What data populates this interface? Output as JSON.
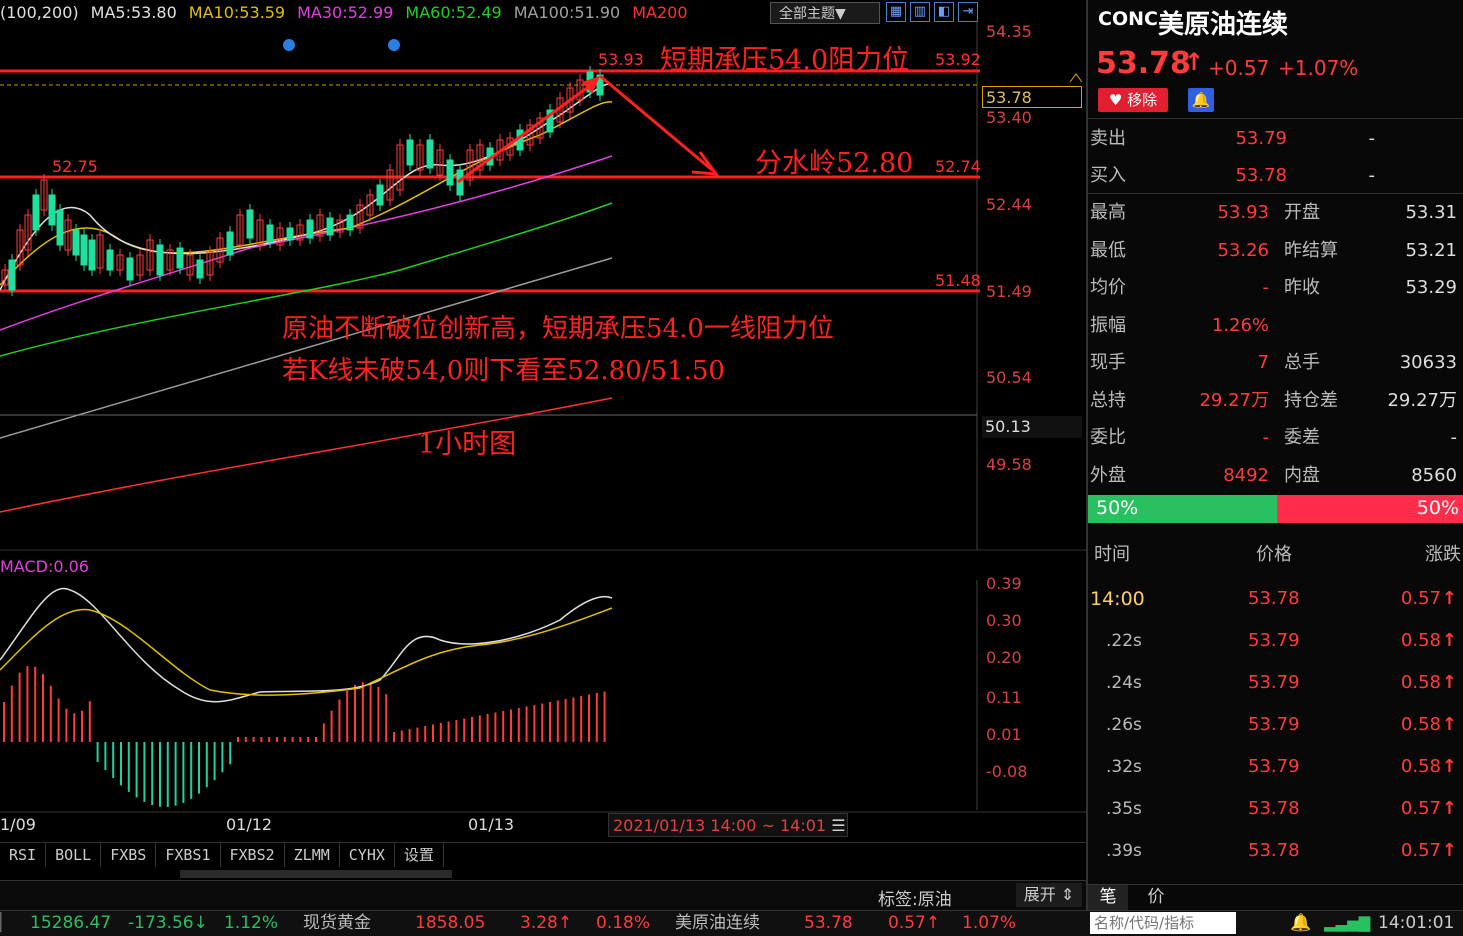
{
  "ma_legend": [
    {
      "text": "(100,200)",
      "color": "#e0e0e0"
    },
    {
      "text": "MA5:53.80",
      "color": "#e0e0e0"
    },
    {
      "text": "MA10:53.59",
      "color": "#e0c000"
    },
    {
      "text": "MA30:52.99",
      "color": "#e040e0"
    },
    {
      "text": "MA60:52.49",
      "color": "#20d020"
    },
    {
      "text": "MA100:51.90",
      "color": "#a0a0a0"
    },
    {
      "text": "MA200",
      "color": "#ff3030"
    }
  ],
  "toolbar": {
    "theme": "全部主题▼",
    "icons": [
      "grid-icon",
      "columns-icon",
      "chart-icon",
      "export-icon"
    ]
  },
  "price_axis": [
    "54.35",
    "53.40",
    "52.44",
    "51.49",
    "50.54",
    "49.58"
  ],
  "current_price_tag": "53.78",
  "crosshair_price_tag": "50.13",
  "level_labels": {
    "high": "53.93",
    "right_high": "53.92",
    "left_mid": "52.75",
    "right_mid": "52.74",
    "right_low": "51.48"
  },
  "annotations": {
    "resistance": "短期承压54.0阻力位",
    "watershed": "分水岭52.80",
    "line1": "原油不断破位创新高，短期承压54.0一线阻力位",
    "line2": "若K线未破54,0则下看至52.80/51.50",
    "timeframe": "1小时图"
  },
  "macd_label": "MACD:0.06",
  "macd_axis": [
    "0.39",
    "0.30",
    "0.20",
    "0.11",
    "0.01",
    "-0.08"
  ],
  "date_axis": [
    "1/09",
    "01/12",
    "01/13"
  ],
  "time_range": "2021/01/13 14:00 ~ 14:01",
  "indicator_tabs": [
    "RSI",
    "BOLL",
    "FXBS",
    "FXBS1",
    "FXBS2",
    "ZLMM",
    "CYHX",
    "设置"
  ],
  "tag_label": "标签:原油",
  "expand_label": "展开 ⇕",
  "quote": {
    "code": "CONC",
    "name": "美原油连续",
    "price": "53.78",
    "arrow": "↑",
    "change": "+0.57",
    "change_pct": "+1.07%",
    "remove_btn": "移除",
    "ask_label": "卖出",
    "ask": "53.79",
    "ask_vol": "-",
    "bid_label": "买入",
    "bid": "53.78",
    "bid_vol": "-"
  },
  "stats": [
    {
      "k1": "最高",
      "v1": "53.93",
      "k2": "开盘",
      "v2": "53.31"
    },
    {
      "k1": "最低",
      "v1": "53.26",
      "k2": "昨结算",
      "v2": "53.21"
    },
    {
      "k1": "均价",
      "v1": "-",
      "k2": "昨收",
      "v2": "53.29"
    },
    {
      "k1": "振幅",
      "v1": "1.26%",
      "k2": "",
      "v2": ""
    },
    {
      "k1": "现手",
      "v1": "7",
      "k2": "总手",
      "v2": "30633"
    },
    {
      "k1": "总持",
      "v1": "29.27万",
      "k2": "持仓差",
      "v2": "29.27万"
    },
    {
      "k1": "委比",
      "v1": "-",
      "k2": "委差",
      "v2": "-"
    },
    {
      "k1": "外盘",
      "v1": "8492",
      "k2": "内盘",
      "v2": "8560"
    }
  ],
  "ratio": {
    "left": "50%",
    "right": "50%",
    "left_fraction": 0.5
  },
  "ticks_header": {
    "time": "时间",
    "price": "价格",
    "change": "涨跌"
  },
  "ticks": [
    {
      "time": "14:00",
      "price": "53.78",
      "change": "0.57"
    },
    {
      "time": ".22s",
      "price": "53.79",
      "change": "0.58"
    },
    {
      "time": ".24s",
      "price": "53.79",
      "change": "0.58"
    },
    {
      "time": ".26s",
      "price": "53.79",
      "change": "0.58"
    },
    {
      "time": ".32s",
      "price": "53.79",
      "change": "0.58"
    },
    {
      "time": ".35s",
      "price": "53.78",
      "change": "0.57"
    },
    {
      "time": ".39s",
      "price": "53.78",
      "change": "0.57"
    }
  ],
  "panel_tabs": [
    "笔",
    "价"
  ],
  "bottom_bar": {
    "index_value": "15286.47",
    "index_change": "-173.56↓",
    "index_pct": "1.12%",
    "gold_name": "现货黄金",
    "gold_value": "1858.05",
    "gold_change": "3.28↑",
    "gold_pct": "0.18%",
    "oil_name": "美原油连续",
    "oil_value": "53.78",
    "oil_change": "0.57↑",
    "oil_pct": "1.07%",
    "search_placeholder": "名称/代码/指标",
    "clock": "14:01:01"
  }
}
